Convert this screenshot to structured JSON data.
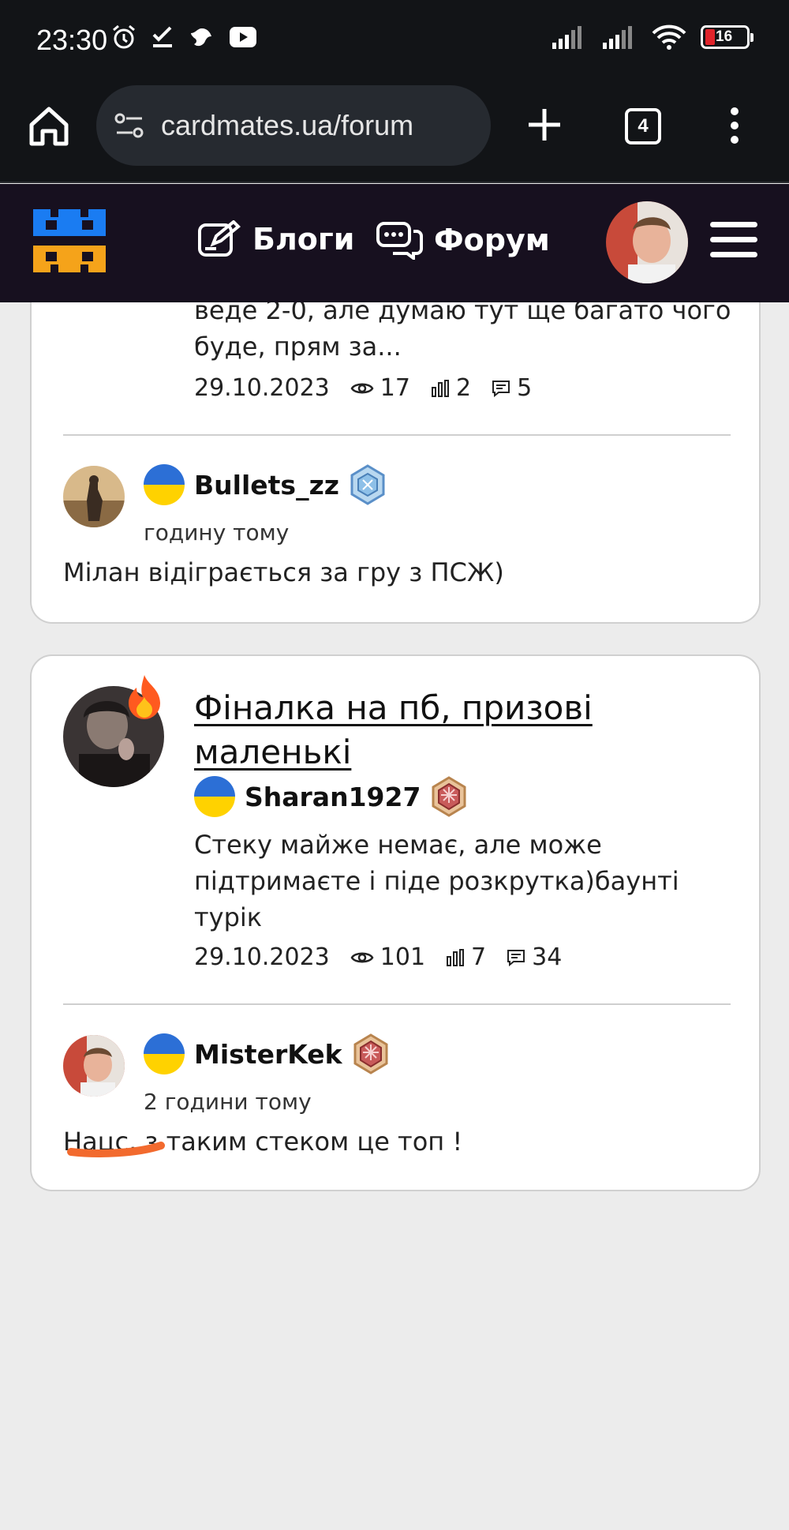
{
  "status_bar": {
    "time": "23:30",
    "battery": "16",
    "left_icons": [
      "alarm-icon",
      "task-check-icon",
      "bird-icon",
      "youtube-icon"
    ],
    "right_icons": [
      "signal-icon",
      "signal-icon",
      "wifi-icon",
      "battery-icon"
    ]
  },
  "browser": {
    "url": "cardmates.ua/forum",
    "tab_count": "4"
  },
  "site_header": {
    "nav_blogs": "Блоги",
    "nav_forum": "Форум",
    "logo_colors": {
      "top": "#1a7cf2",
      "bottom": "#f5a31a"
    }
  },
  "posts": [
    {
      "snippet_lines": [
        "веде 2-0, але думаю тут ще багато чого",
        "буде, прям за..."
      ],
      "date": "29.10.2023",
      "views": "17",
      "votes": "2",
      "comments": "5",
      "last_comment": {
        "username": "Bullets_zz",
        "time_ago": "годину тому",
        "text": "Мілан відіграється за гру з ПСЖ)"
      }
    },
    {
      "title": "Фіналка на пб, призові маленькі",
      "author": "Sharan1927",
      "snippet": "Стеку майже немає, але може підтримаєте і піде розкрутка)баунті турік",
      "date": "29.10.2023",
      "views": "101",
      "votes": "7",
      "comments": "34",
      "last_comment": {
        "username": "MisterKek",
        "time_ago": "2 години тому",
        "text": "Нацс, з таким стеком це топ !"
      }
    }
  ],
  "colors": {
    "header_bg": "#17101f",
    "annotation": "#f26a2e",
    "flag_blue": "#2c6fd6",
    "flag_yellow": "#ffd200"
  }
}
